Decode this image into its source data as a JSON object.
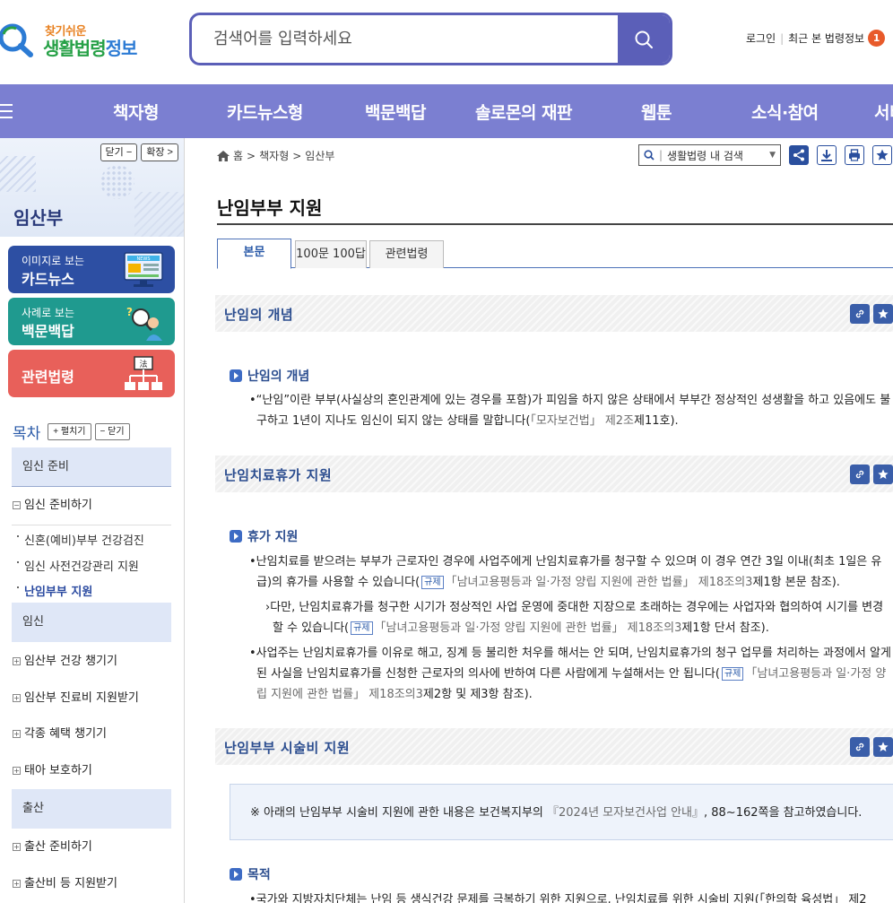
{
  "header": {
    "logo_small": "찾기쉬운",
    "logo_big_green": "생활법령",
    "logo_big_blue": "정보",
    "search_placeholder": "검색어를 입력하세요",
    "login": "로그인",
    "recent": "최근 본 법령정보",
    "recent_count": "1"
  },
  "gnb": {
    "items": [
      "책자형",
      "카드뉴스형",
      "백문백답",
      "솔로몬의 재판",
      "웹툰",
      "소식·참여",
      "서비"
    ]
  },
  "lnb": {
    "close_btn": "닫기 −",
    "expand_btn": "확장 >",
    "title": "임산부",
    "banners": {
      "card_small": "이미지로 보는",
      "card_big": "카드뉴스",
      "qa_small": "사례로 보는",
      "qa_big": "백문백답",
      "law": "관련법령",
      "news_label": "NEWS",
      "law_label": "法"
    },
    "toc_title": "목차",
    "toc_expand": "+ 펼치기",
    "toc_collapse": "− 닫기",
    "sections": [
      "임신 준비",
      "임신",
      "출산"
    ],
    "items": {
      "prep": "임신 준비하기",
      "sub1": "신혼(예비)부부 건강검진",
      "sub2": "임신 사전건강관리 지원",
      "sub3": "난임부부 지원",
      "preg1": "임산부 건강 챙기기",
      "preg2": "임산부 진료비 지원받기",
      "preg3": "각종 혜택 챙기기",
      "preg4": "태아 보호하기",
      "birth1": "출산 준비하기",
      "birth2": "출산비 등 지원받기"
    },
    "minus": "−",
    "plus": "+"
  },
  "content": {
    "breadcrumb": {
      "home": "홈",
      "sep": ">",
      "level1": "책자형",
      "level2": "임산부"
    },
    "inner_search": "생활법령 내 검색",
    "page_title": "난임부부 지원",
    "tabs": [
      "본문",
      "100문 100답",
      "관련법령"
    ],
    "sections": {
      "s1": "난임의 개념",
      "s1_sub": "난임의 개념",
      "s1_p1_a": "•“난임”이란 부부(사실상의 혼인관계에 있는 경우를 포함)가 피임을 하지 않은 상태에서 부부간 정상적인 성생활을 하고 있음에도 불구하고 1년이 지나도 임신이 되지 않는 상태를 말합니다(",
      "s1_p1_ref": "「모자보건법」 제2조",
      "s1_p1_b": "제11호).",
      "s2": "난임치료휴가 지원",
      "s2_sub": "휴가 지원",
      "s2_p1_a": "•난임치료를 받으려는 부부가 근로자인 경우에 사업주에게 난임치료휴가를 청구할 수 있으며 이 경우 연간 3일 이내(최초 1일은 유급)의 휴가를 사용할 수 있습니다(",
      "s2_p1_ref": "「남녀고용평등과 일·가정 양립 지원에 관한 법률」 제18조의3",
      "s2_p1_b": "제1항 본문 참조).",
      "s2_p2_a": "›다만, 난임치료휴가를 청구한 시기가 정상적인 사업 운영에 중대한 지장으로 초래하는 경우에는 사업자와 협의하여 시기를 변경할 수 있습니다(",
      "s2_p2_ref": "「남녀고용평등과 일·가정 양립 지원에 관한 법률」 제18조의3",
      "s2_p2_b": "제1항 단서 참조).",
      "s2_p3_a": "•사업주는 난임치료휴가를 이유로 해고, 징계 등 불리한 처우를 해서는 안 되며, 난임치료휴가의 청구 업무를 처리하는 과정에서 알게 된 사실을 난임치료휴가를 신청한 근로자의 의사에 반하여 다른 사람에게 누설해서는 안 됩니다(",
      "s2_p3_ref": "「남녀고용평등과 일·가정 양립 지원에 관한 법률」 제18조의3",
      "s2_p3_b": "제2항 및 제3항 참조).",
      "tag": "규제",
      "s3": "난임부부 시술비 지원",
      "s3_info_a": "※ 아래의 난임부부 시술비 지원에 관한 내용은 보건복지부의 ",
      "s3_info_ref": "『2024년 모자보건사업 안내』",
      "s3_info_b": ", 88~162쪽을 참고하였습니다.",
      "s3_sub": "목적",
      "s3_p1": "•국가와 지방자치단체는 난임 등 생식건강 문제를 극복하기 위한 지원으로, 난임치료를 위한 시술비 지원(「한의학 육성법」 제2"
    }
  }
}
